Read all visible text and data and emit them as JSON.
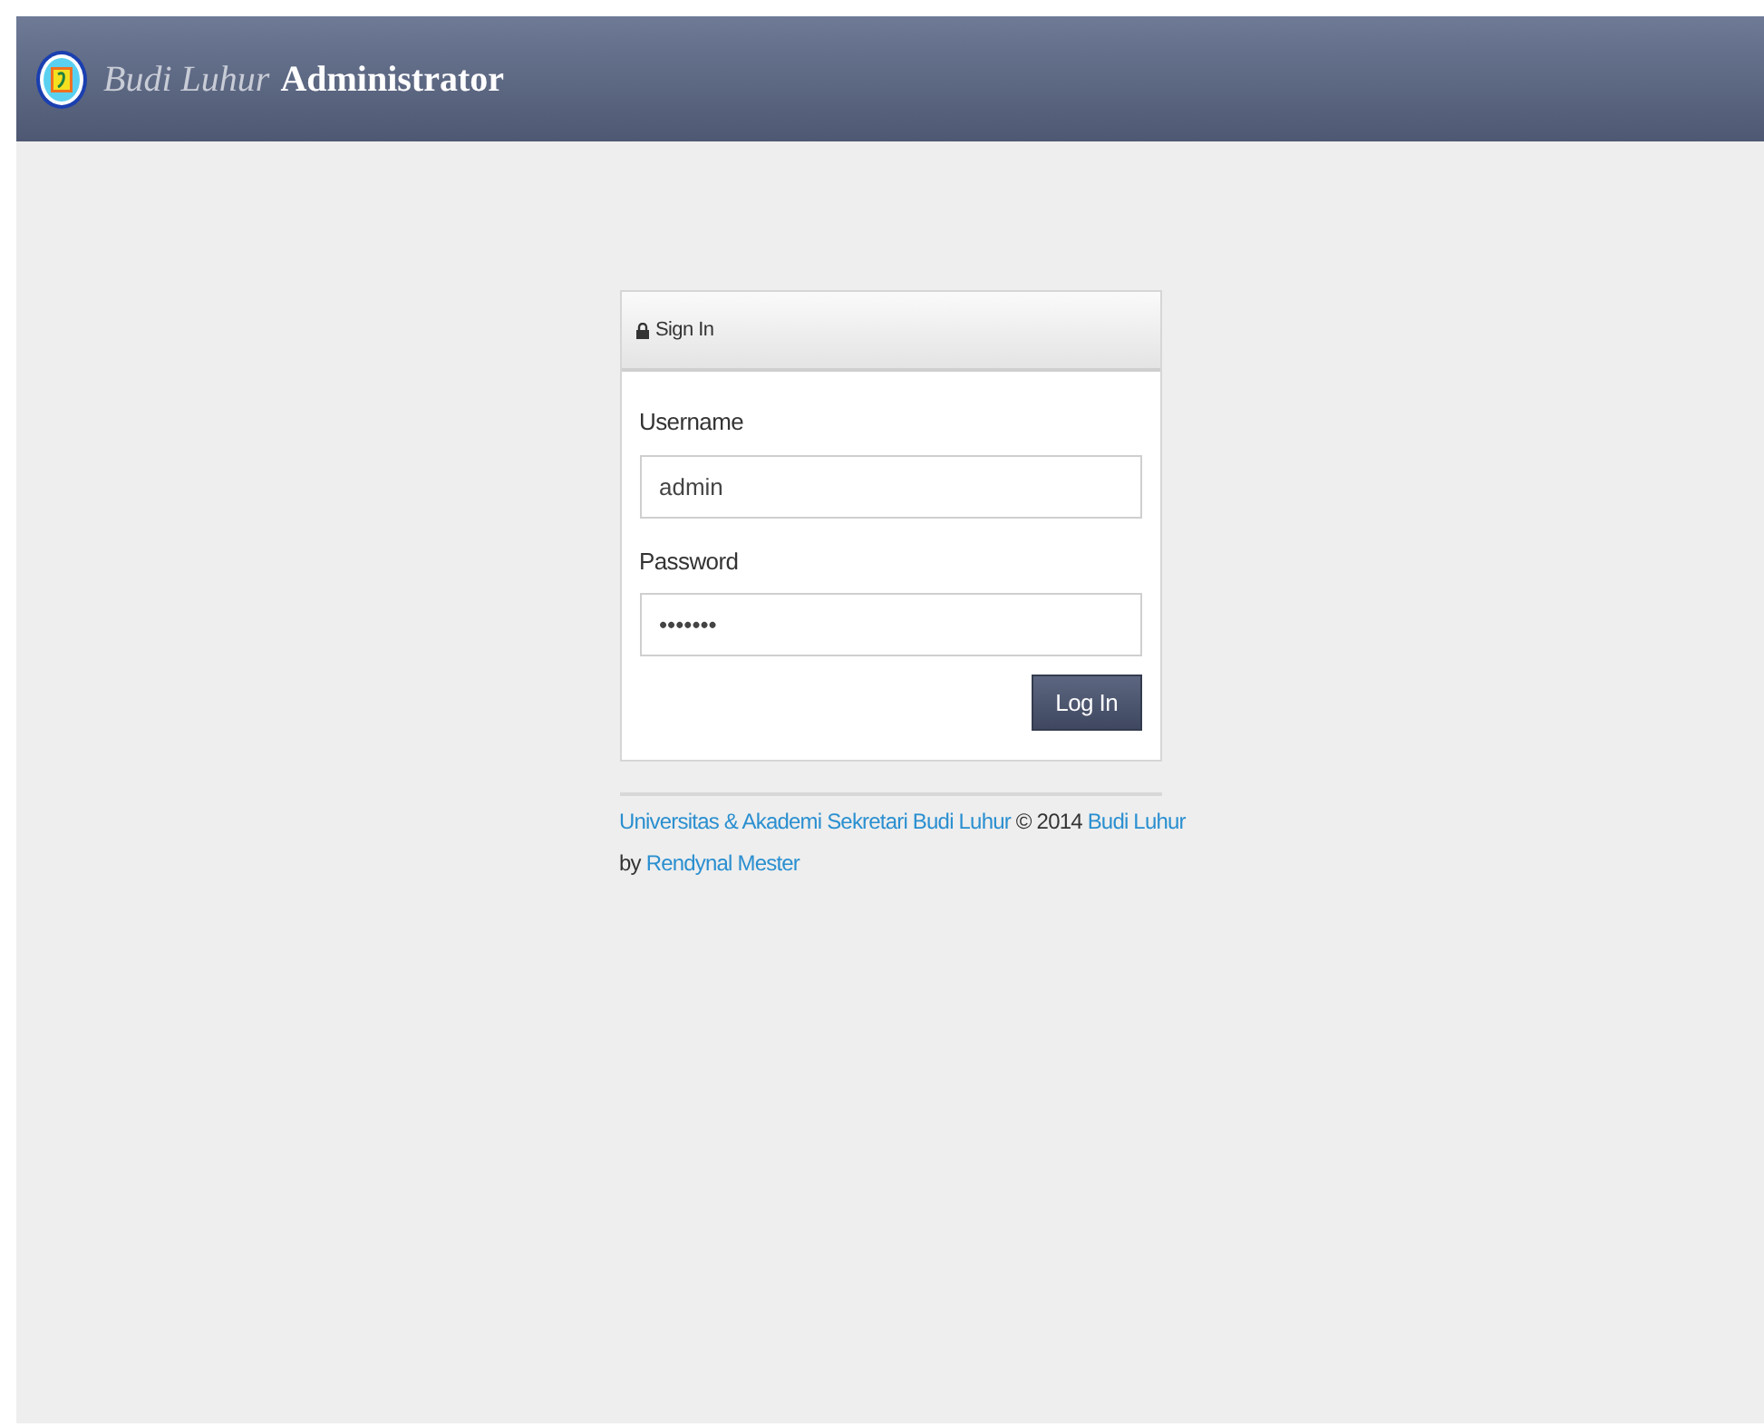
{
  "header": {
    "brand": "Budi Luhur",
    "title": "Administrator"
  },
  "login_panel": {
    "title": "Sign In",
    "fields": [
      {
        "label": "Username",
        "value": "admin"
      },
      {
        "label": "Password",
        "value": "•••••••"
      }
    ],
    "button": "Log In"
  },
  "footer": {
    "lines": [
      [
        {
          "kind": "link",
          "text": "Universitas & Akademi Sekretari Budi Luhur"
        },
        {
          "kind": "text",
          "text": " © 2014 "
        },
        {
          "kind": "link",
          "text": "Budi Luhur"
        }
      ],
      [
        {
          "kind": "text",
          "text": "by "
        },
        {
          "kind": "link",
          "text": "Rendynal Mester"
        }
      ]
    ]
  }
}
